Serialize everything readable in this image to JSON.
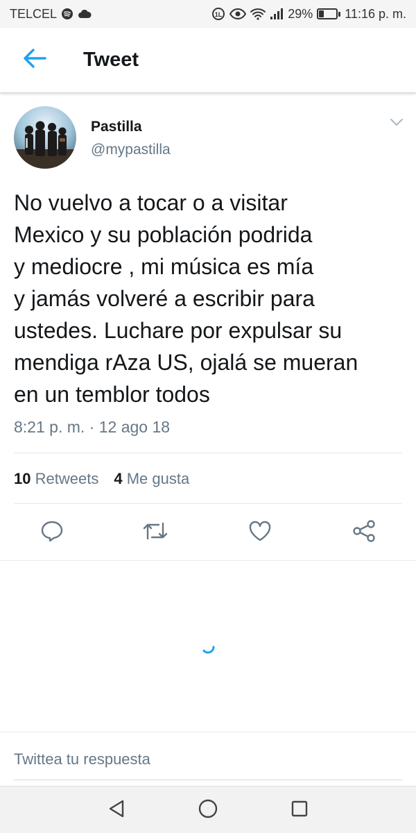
{
  "status_bar": {
    "carrier": "TELCEL",
    "battery": "29%",
    "battery_level": 0.29,
    "time": "11:16 p. m."
  },
  "header": {
    "title": "Tweet"
  },
  "tweet": {
    "display_name": "Pastilla",
    "username": "@mypastilla",
    "text": "No vuelvo a tocar o a visitar\nMexico y su población podrida\ny mediocre , mi música es mía\ny jamás volveré a escribir para\nustedes.  Luchare por expulsar su\nmendiga rAza US, ojalá se mueran\nen un temblor todos",
    "timestamp": "8:21 p. m. · 12 ago 18",
    "retweet_count": "10",
    "retweet_label": "Retweets",
    "like_count": "4",
    "like_label": "Me gusta"
  },
  "reply": {
    "placeholder": "Twittea tu respuesta"
  },
  "colors": {
    "accent": "#1da1f2",
    "secondary_text": "#657786",
    "primary_text": "#14171a"
  }
}
